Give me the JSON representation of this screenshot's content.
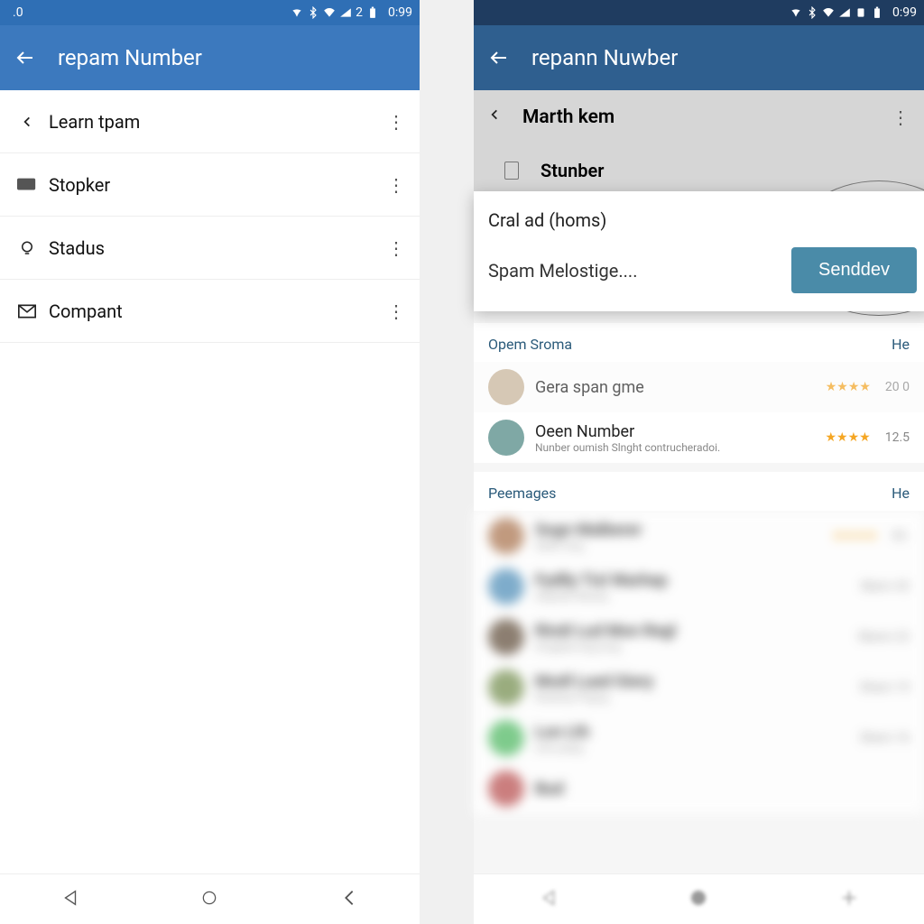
{
  "left": {
    "status": {
      "left_indicator": ".0",
      "time": "0:99"
    },
    "title": "repam Number",
    "items": [
      {
        "icon": "chevron-left-icon",
        "label": "Learn tpam"
      },
      {
        "icon": "rect-icon",
        "label": "Stopker"
      },
      {
        "icon": "bulb-icon",
        "label": "Stadus"
      },
      {
        "icon": "envelope-icon",
        "label": "Compant"
      }
    ]
  },
  "right": {
    "status": {
      "time": "0:99"
    },
    "title": "repann Nuwber",
    "header": "Marth kem",
    "under": "Stunber",
    "popup": {
      "line1": "Cral ad (homs)",
      "line2": "Spam Melostige....",
      "button": "Senddev"
    },
    "section1": {
      "title": "Opem Sroma",
      "more": "He"
    },
    "results1": [
      {
        "name": "Gera span gme",
        "sub": "",
        "stars": "★★★★",
        "score": "20 0"
      },
      {
        "name": "Oeen Number",
        "sub": "Nunber oumish Slnght contrucheradoi.",
        "stars": "★★★★",
        "score": "12.5"
      }
    ],
    "section2": {
      "title": "Peemages",
      "more": "He"
    },
    "results2": [
      {
        "name": "Sogn Malberer",
        "sub": "Setel Jnrg",
        "stars": "★★★★",
        "score": "02."
      },
      {
        "name": "Fydlly Tisl Warhep",
        "sub": "Anpoter Rerany",
        "stars": "",
        "score": "Skern 42"
      },
      {
        "name": "Rindi Lud Mon Regl",
        "sub": "Srngteet eng erng",
        "stars": "",
        "score": "Skenn 22"
      },
      {
        "name": "Modl Lued Giery",
        "sub": "Rnatney Pngrrg",
        "stars": "",
        "score": "Sharn 15"
      },
      {
        "name": "Lon Lth",
        "sub": "sron pang",
        "stars": "",
        "score": "Shern 16"
      },
      {
        "name": "Bud",
        "sub": "",
        "stars": "",
        "score": ""
      }
    ]
  }
}
